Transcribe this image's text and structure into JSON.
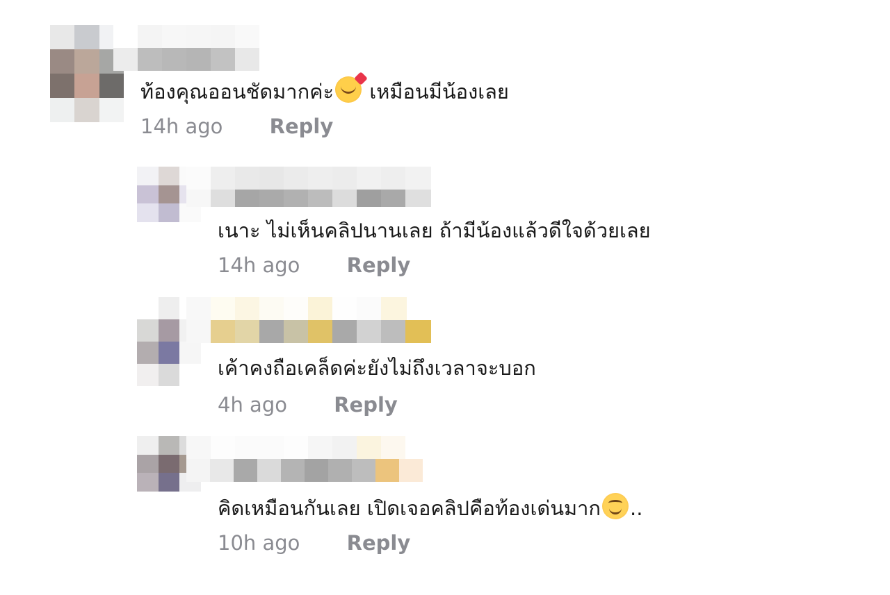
{
  "comments": [
    {
      "text_before": "ท้องคุณออนชัดมากค่ะ",
      "emoji": "smiling-face-with-hearts",
      "text_after": " เหมือนมีน้องเลย",
      "time": "14h ago",
      "reply": "Reply"
    },
    {
      "text": "เนาะ ไม่เห็นคลิปนานเลย ถ้ามีน้องแล้วดีใจด้วยเลย",
      "time": "14h ago",
      "reply": "Reply"
    },
    {
      "text": "เค้าคงถือเคล็ดค่ะยังไม่ถึงเวลาจะบอก",
      "time": "4h ago",
      "reply": "Reply"
    },
    {
      "text_before": "คิดเหมือนกันเลย เปิดเจอคลิปคือท้องเด่นมาก",
      "emoji": "smiling-face",
      "text_after": "..",
      "time": "10h ago",
      "reply": "Reply"
    }
  ],
  "colors": {
    "text": "#1a1a1a",
    "meta": "#8a8b91"
  }
}
